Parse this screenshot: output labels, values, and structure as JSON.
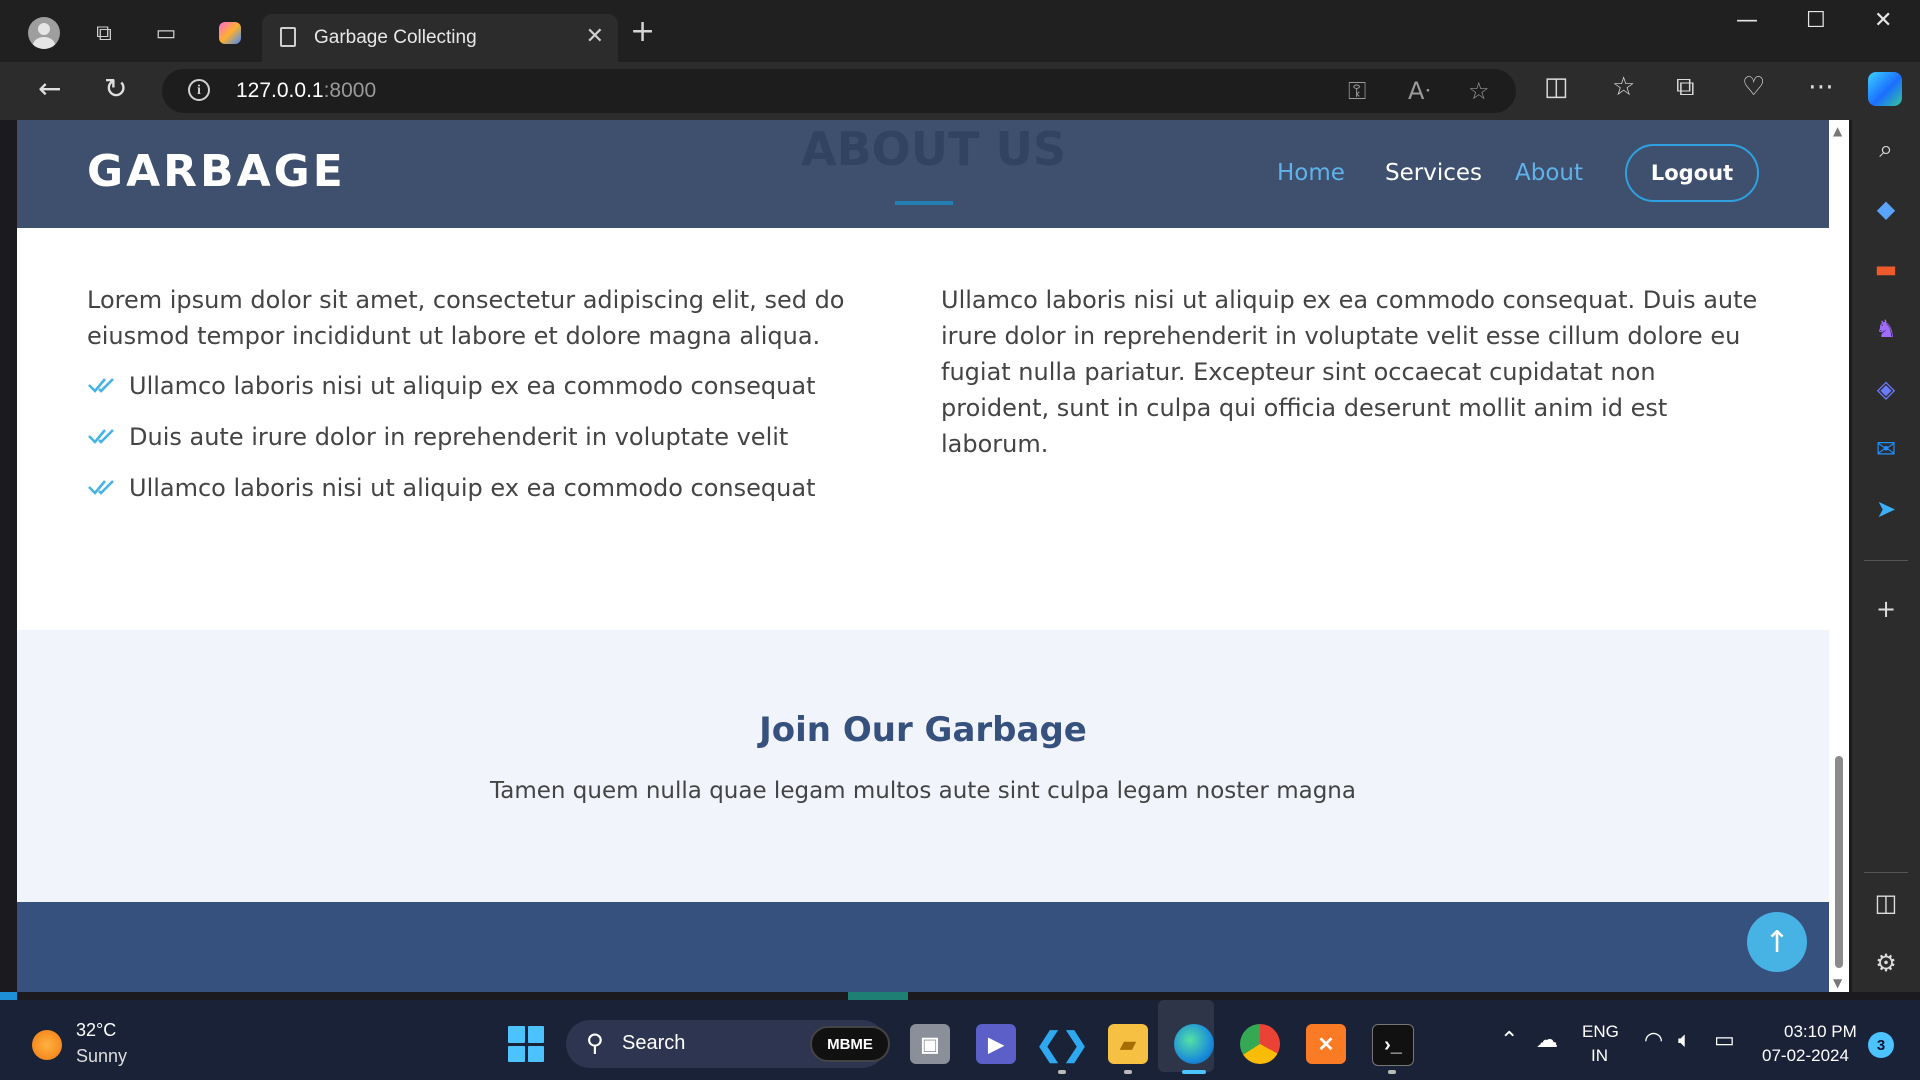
{
  "browser": {
    "tab_title": "Garbage Collecting",
    "url_host": "127.0.0.1",
    "url_port": ":8000"
  },
  "site": {
    "logo": "GARBAGE",
    "ghost_heading": "ABOUT US",
    "nav": {
      "home": "Home",
      "services": "Services",
      "about": "About",
      "logout": "Logout"
    },
    "about": {
      "left_paragraph": "Lorem ipsum dolor sit amet, consectetur adipiscing elit, sed do eiusmod tempor incididunt ut labore et dolore magna aliqua.",
      "checks": [
        "Ullamco laboris nisi ut aliquip ex ea commodo consequat",
        "Duis aute irure dolor in reprehenderit in voluptate velit",
        "Ullamco laboris nisi ut aliquip ex ea commodo consequat"
      ],
      "right_paragraph": "Ullamco laboris nisi ut aliquip ex ea commodo consequat. Duis aute irure dolor in reprehenderit in voluptate velit esse cillum dolore eu fugiat nulla pariatur. Excepteur sint occaecat cupidatat non proident, sunt in culpa qui officia deserunt mollit anim id est laborum."
    },
    "join": {
      "title": "Join Our Garbage",
      "subtitle": "Tamen quem nulla quae legam multos aute sint culpa legam noster magna"
    },
    "colors": {
      "header": "#3e506e",
      "footer": "#37517e",
      "accent": "#47b2e4"
    }
  },
  "taskbar": {
    "weather_temp": "32°C",
    "weather_cond": "Sunny",
    "search_label": "Search",
    "mbme_label": "MBME",
    "lang_primary": "ENG",
    "lang_secondary": "IN",
    "time": "03:10 PM",
    "date": "07-02-2024",
    "notifications": "3"
  },
  "icons": {
    "titlebar": [
      "profile-icon",
      "workspaces-icon",
      "vertical-tabs-icon",
      "copilot-icon",
      "page-icon",
      "close-icon",
      "new-tab-icon"
    ],
    "window": [
      "minimize-icon",
      "maximize-icon",
      "window-close-icon"
    ],
    "toolbar": [
      "back-icon",
      "refresh-icon",
      "info-icon",
      "key-icon",
      "read-aloud-icon",
      "star-icon",
      "split-screen-icon",
      "favorites-icon",
      "collections-icon",
      "health-icon",
      "more-icon"
    ],
    "sidebar": [
      "search-icon",
      "tag-icon",
      "toolbox-icon",
      "games-icon",
      "copilot-icon",
      "outlook-icon",
      "send-icon",
      "add-icon",
      "sidebar-toggle-icon",
      "settings-icon"
    ]
  }
}
